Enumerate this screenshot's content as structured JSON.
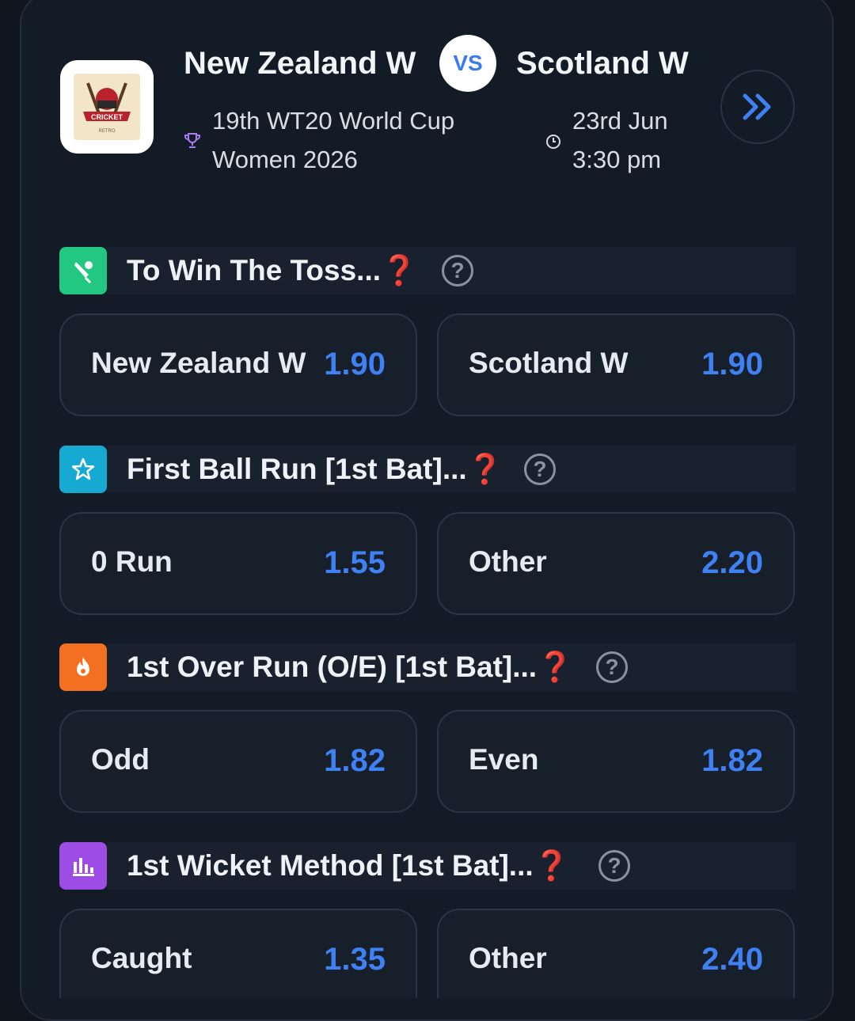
{
  "match": {
    "team1": "New Zealand W",
    "vs": "VS",
    "team2": "Scotland W",
    "tournament_line1": "19th WT20 World Cup",
    "tournament_line2": "Women 2026",
    "date": "23rd Jun",
    "time": "3:30 pm",
    "logo_text": "CRICKET",
    "logo_subtext": "RETRO"
  },
  "colors": {
    "accent": "#3f80f2",
    "toss_icon_bg": "#22c781",
    "first_ball_icon_bg": "#16a9d1",
    "first_over_icon_bg": "#f2701f",
    "wicket_icon_bg": "#9d4ce6"
  },
  "markets": [
    {
      "title": "To Win The Toss...❓",
      "icon": "cricket-bat-ball-icon",
      "options": [
        {
          "label": "New Zealand W",
          "odds": "1.90"
        },
        {
          "label": "Scotland W",
          "odds": "1.90"
        }
      ]
    },
    {
      "title": "First Ball Run [1st Bat]...❓",
      "icon": "star-icon",
      "options": [
        {
          "label": "0 Run",
          "odds": "1.55"
        },
        {
          "label": "Other",
          "odds": "2.20"
        }
      ]
    },
    {
      "title": "1st Over Run (O/E) [1st Bat]...❓",
      "icon": "fire-icon",
      "options": [
        {
          "label": "Odd",
          "odds": "1.82"
        },
        {
          "label": "Even",
          "odds": "1.82"
        }
      ]
    },
    {
      "title": "1st Wicket Method [1st Bat]...❓",
      "icon": "bar-chart-icon",
      "options": [
        {
          "label": "Caught",
          "odds": "1.35"
        },
        {
          "label": "Other",
          "odds": "2.40"
        }
      ]
    }
  ]
}
